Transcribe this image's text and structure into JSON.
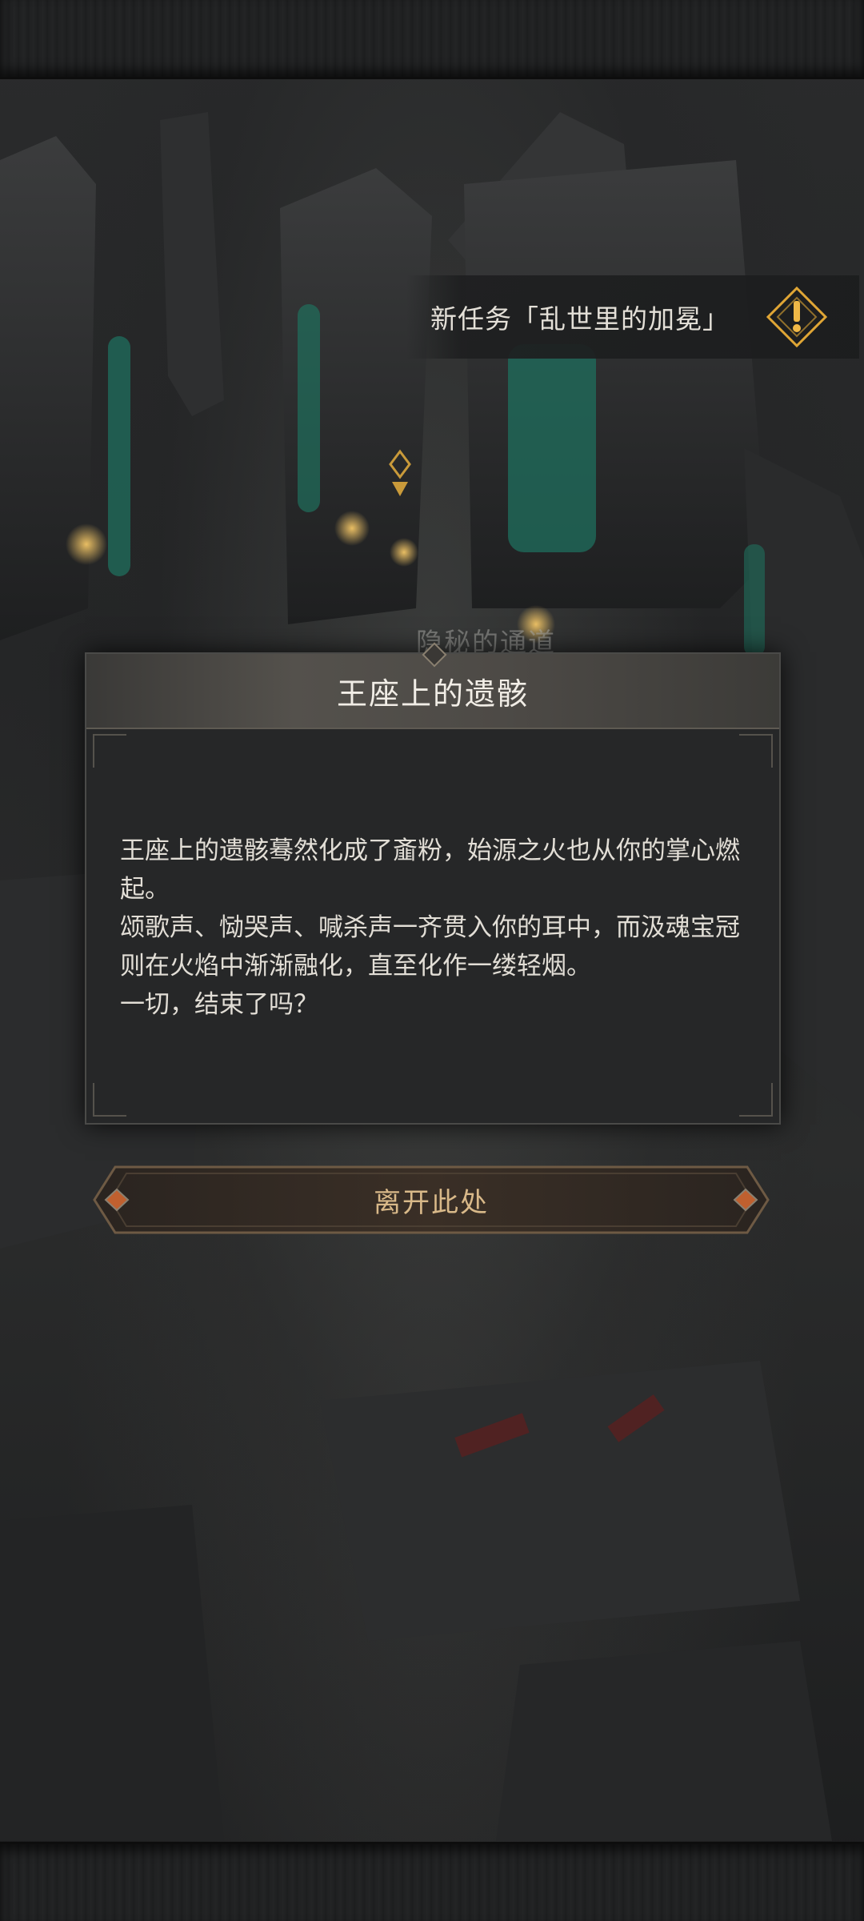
{
  "quest_banner": {
    "text": "新任务「乱世里的加冕」",
    "icon": "quest-alert-icon",
    "accent": "#e0a635"
  },
  "location": {
    "label": "隐秘的通道"
  },
  "dialog": {
    "title": "王座上的遗骸",
    "paragraphs": [
      "王座上的遗骸蓦然化成了齑粉，始源之火也从你的掌心燃起。",
      "颂歌声、恸哭声、喊杀声一齐贯入你的耳中，而汲魂宝冠则在火焰中渐渐融化，直至化作一缕轻烟。",
      "一切，结束了吗？"
    ]
  },
  "action": {
    "leave_label": "离开此处",
    "accent": "#c0602f"
  },
  "colors": {
    "gold": "#d9b989",
    "teal_glow": "#1f6f5d"
  }
}
